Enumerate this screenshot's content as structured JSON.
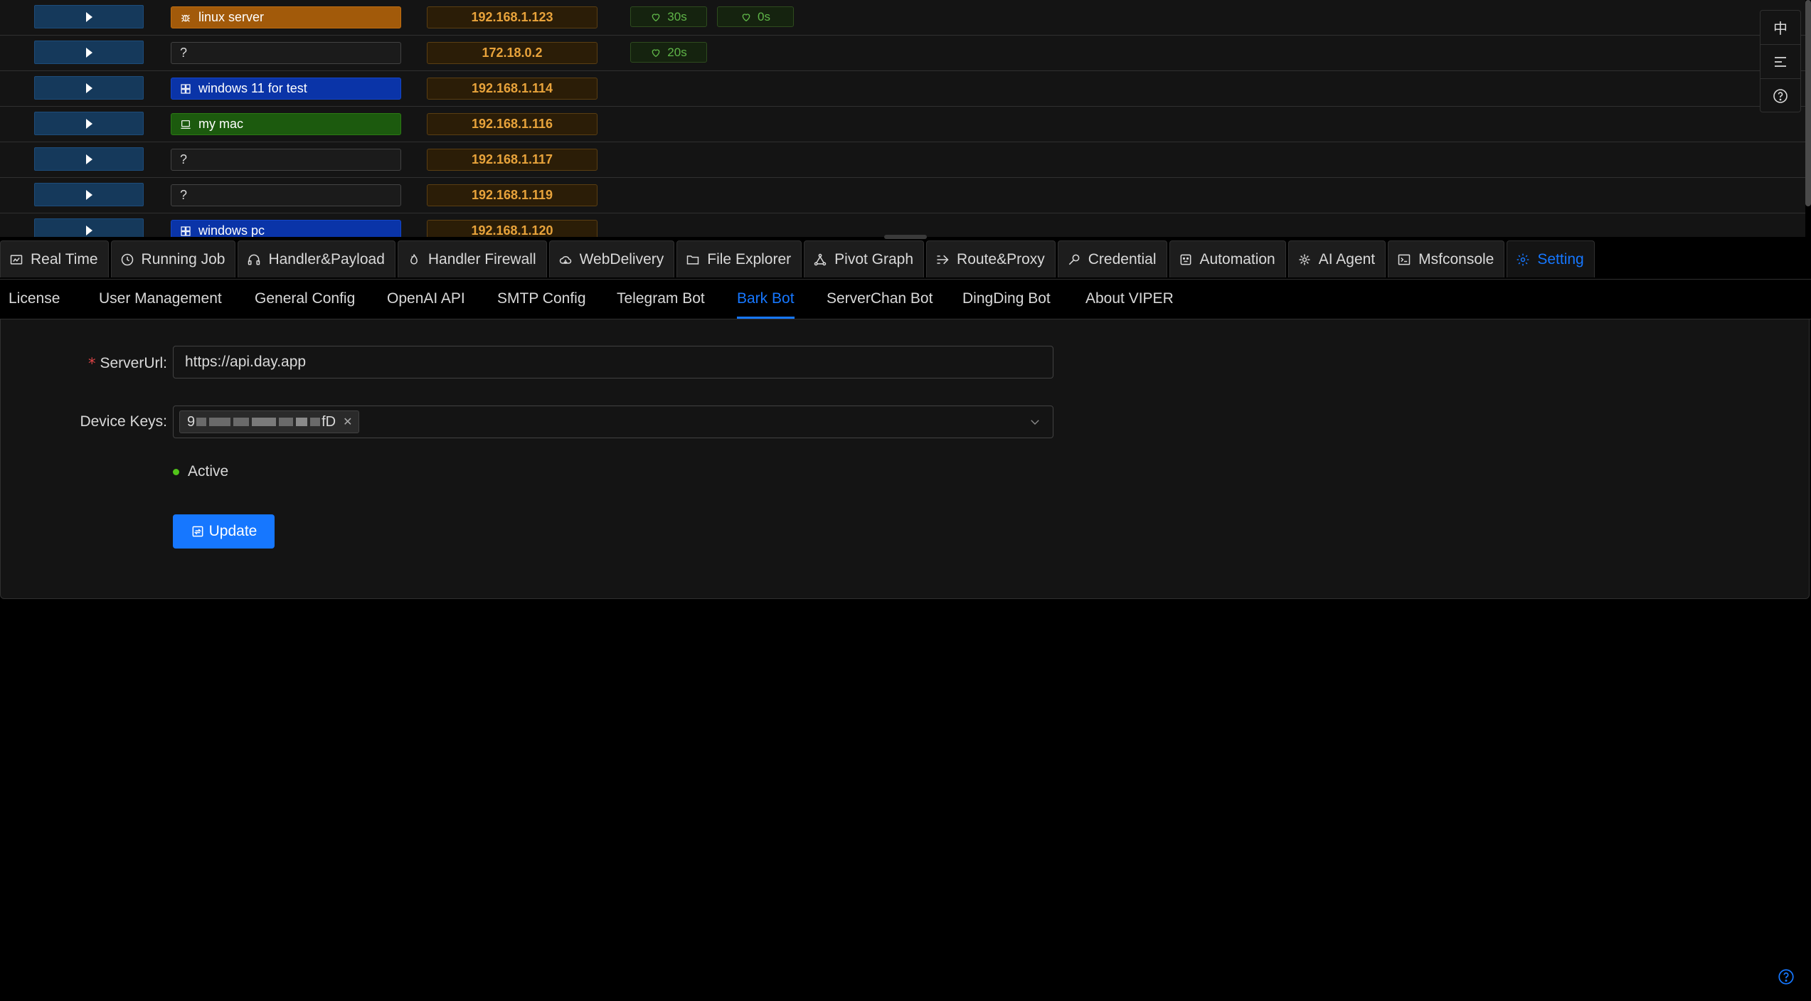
{
  "sessions": [
    {
      "host": "linux server",
      "host_icon": "bug-icon",
      "color": "orange",
      "ip": "192.168.1.123",
      "heartbeats": [
        "30s",
        "0s"
      ]
    },
    {
      "host": "?",
      "host_icon": "",
      "color": "empty",
      "ip": "172.18.0.2",
      "heartbeats": [
        "20s"
      ]
    },
    {
      "host": "windows 11 for test",
      "host_icon": "windows-icon",
      "color": "blue",
      "ip": "192.168.1.114",
      "heartbeats": []
    },
    {
      "host": "my mac",
      "host_icon": "laptop-icon",
      "color": "green",
      "ip": "192.168.1.116",
      "heartbeats": []
    },
    {
      "host": "?",
      "host_icon": "",
      "color": "empty",
      "ip": "192.168.1.117",
      "heartbeats": []
    },
    {
      "host": "?",
      "host_icon": "",
      "color": "empty",
      "ip": "192.168.1.119",
      "heartbeats": []
    },
    {
      "host": "windows pc",
      "host_icon": "windows-icon",
      "color": "blue",
      "ip": "192.168.1.120",
      "heartbeats": []
    }
  ],
  "toolbar": {
    "lang_label": "中"
  },
  "main_tabs": [
    {
      "label": "Real Time",
      "icon": "dashboard-icon"
    },
    {
      "label": "Running Job",
      "icon": "clock-icon"
    },
    {
      "label": "Handler&Payload",
      "icon": "headphones-icon"
    },
    {
      "label": "Handler Firewall",
      "icon": "fire-icon"
    },
    {
      "label": "WebDelivery",
      "icon": "cloud-icon"
    },
    {
      "label": "File Explorer",
      "icon": "folder-icon"
    },
    {
      "label": "Pivot Graph",
      "icon": "graph-icon"
    },
    {
      "label": "Route&Proxy",
      "icon": "route-icon"
    },
    {
      "label": "Credential",
      "icon": "key-icon"
    },
    {
      "label": "Automation",
      "icon": "robot-icon"
    },
    {
      "label": "AI Agent",
      "icon": "ai-icon"
    },
    {
      "label": "Msfconsole",
      "icon": "terminal-icon"
    },
    {
      "label": "Setting",
      "icon": "gear-icon",
      "active": true
    }
  ],
  "sub_tabs": [
    {
      "label": "License"
    },
    {
      "label": "User Management"
    },
    {
      "label": "General Config"
    },
    {
      "label": "OpenAI API"
    },
    {
      "label": "SMTP Config"
    },
    {
      "label": "Telegram Bot"
    },
    {
      "label": "Bark Bot",
      "active": true
    },
    {
      "label": "ServerChan Bot"
    },
    {
      "label": "DingDing Bot"
    },
    {
      "label": "About VIPER"
    }
  ],
  "form": {
    "server_url_label": "ServerUrl",
    "server_url_value": "https://api.day.app",
    "device_keys_label": "Device Keys",
    "device_key_prefix": "9",
    "device_key_suffix": "fD",
    "status_text": "Active",
    "update_label": "Update"
  },
  "colors": {
    "accent": "#1677ff",
    "active_dot": "#52c41a",
    "ip_text": "#e8a33b"
  }
}
